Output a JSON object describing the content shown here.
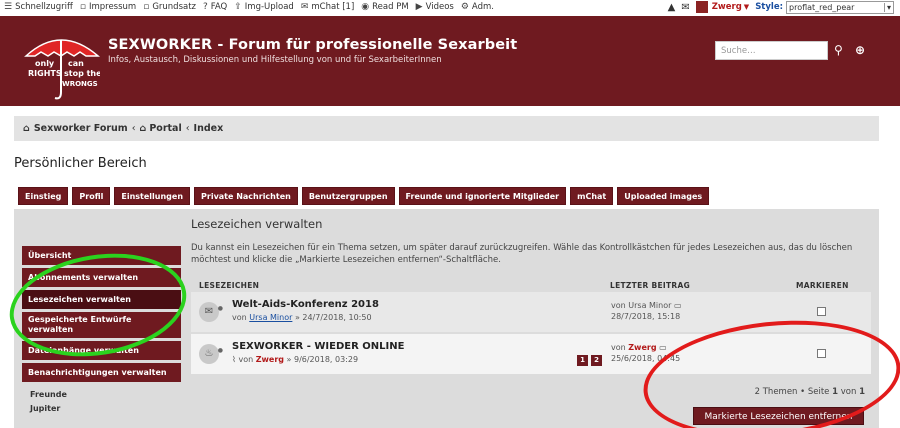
{
  "topbar": {
    "items": [
      "Schnellzugriff",
      "Impressum",
      "Grundsatz",
      "FAQ",
      "Img-Upload",
      "mChat [1]",
      "Read PM",
      "Videos",
      "Adm."
    ],
    "user": "Zwerg",
    "style_label": "Style:",
    "style_value": "proflat_red_pear"
  },
  "header": {
    "title": "SEXWORKER - Forum für professionelle Sexarbeit",
    "desc": "Infos, Austausch, Diskussionen und Hilfestellung von und für SexarbeiterInnen",
    "search_placeholder": "Suche…",
    "logo_text": [
      "only",
      "RIGHTS",
      "can",
      "stop the",
      "WRONGS"
    ]
  },
  "breadcrumb": [
    "Sexworker Forum",
    "Portal",
    "Index"
  ],
  "page_title": "Persönlicher Bereich",
  "tabs": [
    "Einstieg",
    "Profil",
    "Einstellungen",
    "Private Nachrichten",
    "Benutzergruppen",
    "Freunde und ignorierte Mitglieder",
    "mChat",
    "Uploaded images"
  ],
  "sidenav": [
    "Übersicht",
    "Abonnements verwalten",
    "Lesezeichen verwalten",
    "Gespeicherte Entwürfe verwalten",
    "Dateianhänge verwalten",
    "Benachrichtigungen verwalten"
  ],
  "friends": {
    "label": "Freunde",
    "items": [
      "Jupiter"
    ]
  },
  "main": {
    "title": "Lesezeichen verwalten",
    "desc": "Du kannst ein Lesezeichen für ein Thema setzen, um später darauf zurückzugreifen. Wähle das Kontrollkästchen für jedes Lesezeichen aus, das du löschen möchtest und klicke die „Markierte Lesezeichen entfernen“-Schaltfläche.",
    "col_bookmarks": "LESEZEICHEN",
    "col_last": "LETZTER BEITRAG",
    "col_mark": "MARKIEREN",
    "rows": [
      {
        "title": "Welt-Aids-Konferenz 2018",
        "by": "von",
        "author": "Ursa Minor",
        "date": "» 24/7/2018, 10:50",
        "last_by": "von",
        "last_author": "Ursa Minor",
        "last_date": "28/7/2018, 15:18"
      },
      {
        "title": "SEXWORKER - WIEDER ONLINE",
        "by": "von",
        "author": "Zwerg",
        "date": "» 9/6/2018, 03:29",
        "pages": [
          "1",
          "2"
        ],
        "last_by": "von",
        "last_author": "Zwerg",
        "last_date": "25/6/2018, 04:45"
      }
    ],
    "counts_prefix": "2 Themen • Seite",
    "page_current": "1",
    "counts_mid": "von",
    "page_total": "1",
    "remove_button": "Markierte Lesezeichen entfernen"
  }
}
